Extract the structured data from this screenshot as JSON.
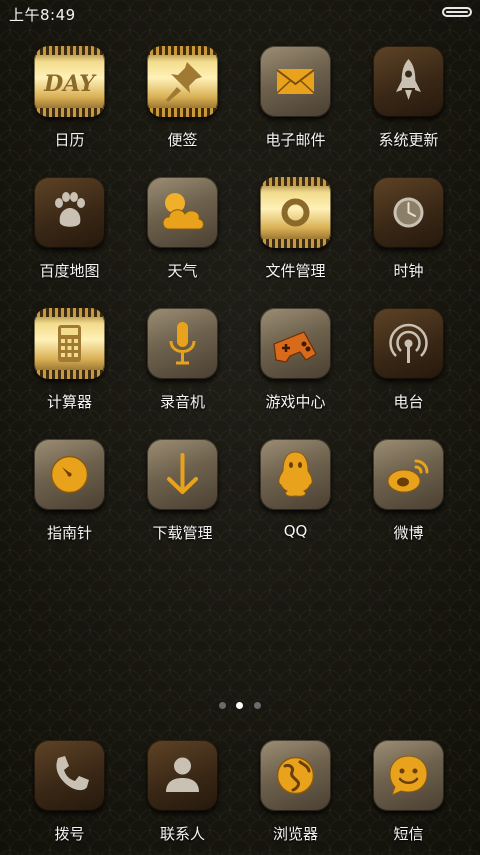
{
  "status_bar": {
    "time": "上午8:49",
    "battery_icon": "battery-icon"
  },
  "apps": [
    {
      "label": "日历",
      "icon": "calendar-icon"
    },
    {
      "label": "便签",
      "icon": "pushpin-icon"
    },
    {
      "label": "电子邮件",
      "icon": "envelope-icon"
    },
    {
      "label": "系统更新",
      "icon": "rocket-icon"
    },
    {
      "label": "百度地图",
      "icon": "paw-icon"
    },
    {
      "label": "天气",
      "icon": "cloud-sun-icon"
    },
    {
      "label": "文件管理",
      "icon": "ring-icon"
    },
    {
      "label": "时钟",
      "icon": "clock-icon"
    },
    {
      "label": "计算器",
      "icon": "calculator-icon"
    },
    {
      "label": "录音机",
      "icon": "microphone-icon"
    },
    {
      "label": "游戏中心",
      "icon": "gamepad-icon"
    },
    {
      "label": "电台",
      "icon": "radio-tower-icon"
    },
    {
      "label": "指南针",
      "icon": "compass-icon"
    },
    {
      "label": "下载管理",
      "icon": "download-arrow-icon"
    },
    {
      "label": "QQ",
      "icon": "penguin-icon"
    },
    {
      "label": "微博",
      "icon": "weibo-icon"
    }
  ],
  "calendar_text": "DAY",
  "page_indicator": {
    "total": 3,
    "active": 2
  },
  "dock": [
    {
      "label": "拨号",
      "icon": "phone-icon"
    },
    {
      "label": "联系人",
      "icon": "contact-icon"
    },
    {
      "label": "浏览器",
      "icon": "globe-icon"
    },
    {
      "label": "短信",
      "icon": "smiley-message-icon"
    }
  ],
  "colors": {
    "accent_gold": "#e8a21c",
    "background": "#151510",
    "label": "#f4f4f4"
  }
}
